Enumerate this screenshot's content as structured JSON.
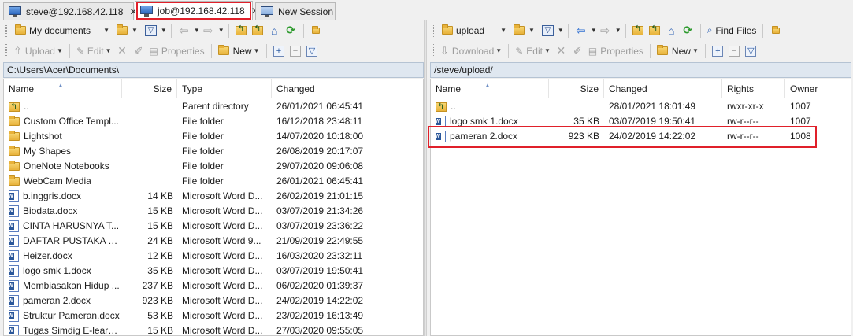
{
  "tabs": [
    {
      "label": "steve@192.168.42.118",
      "close": "✕",
      "active": false
    },
    {
      "label": "job@192.168.42.118",
      "close": "✕",
      "active": true
    },
    {
      "label": "New Session"
    }
  ],
  "left": {
    "location": "My documents",
    "path": "C:\\Users\\Acer\\Documents\\",
    "toolbar2": {
      "upload": "Upload",
      "edit": "Edit",
      "properties": "Properties",
      "new": "New"
    },
    "columns": {
      "name": "Name",
      "size": "Size",
      "type": "Type",
      "changed": "Changed"
    },
    "files": [
      {
        "icon": "updir",
        "name": "..",
        "size": "",
        "type": "Parent directory",
        "changed": "26/01/2021  06:45:41"
      },
      {
        "icon": "folder",
        "name": "Custom Office Templ...",
        "size": "",
        "type": "File folder",
        "changed": "16/12/2018  23:48:11"
      },
      {
        "icon": "folder",
        "name": "Lightshot",
        "size": "",
        "type": "File folder",
        "changed": "14/07/2020  10:18:00"
      },
      {
        "icon": "folder",
        "name": "My Shapes",
        "size": "",
        "type": "File folder",
        "changed": "26/08/2019  20:17:07"
      },
      {
        "icon": "folder",
        "name": "OneNote Notebooks",
        "size": "",
        "type": "File folder",
        "changed": "29/07/2020  09:06:08"
      },
      {
        "icon": "folder",
        "name": "WebCam Media",
        "size": "",
        "type": "File folder",
        "changed": "26/01/2021  06:45:41"
      },
      {
        "icon": "word",
        "name": "b.inggris.docx",
        "size": "14 KB",
        "type": "Microsoft Word D...",
        "changed": "26/02/2019  21:01:15"
      },
      {
        "icon": "word",
        "name": "Biodata.docx",
        "size": "15 KB",
        "type": "Microsoft Word D...",
        "changed": "03/07/2019  21:34:26"
      },
      {
        "icon": "word",
        "name": "CINTA HARUSNYA T...",
        "size": "15 KB",
        "type": "Microsoft Word D...",
        "changed": "03/07/2019  23:36:22"
      },
      {
        "icon": "word",
        "name": "DAFTAR PUSTAKA m...",
        "size": "24 KB",
        "type": "Microsoft Word 9...",
        "changed": "21/09/2019  22:49:55"
      },
      {
        "icon": "word",
        "name": "Heizer.docx",
        "size": "12 KB",
        "type": "Microsoft Word D...",
        "changed": "16/03/2020  23:32:11"
      },
      {
        "icon": "word",
        "name": "logo smk 1.docx",
        "size": "35 KB",
        "type": "Microsoft Word D...",
        "changed": "03/07/2019  19:50:41"
      },
      {
        "icon": "word",
        "name": "Membiasakan Hidup ...",
        "size": "237 KB",
        "type": "Microsoft Word D...",
        "changed": "06/02/2020  01:39:37"
      },
      {
        "icon": "word",
        "name": "pameran 2.docx",
        "size": "923 KB",
        "type": "Microsoft Word D...",
        "changed": "24/02/2019  14:22:02"
      },
      {
        "icon": "word",
        "name": "Struktur Pameran.docx",
        "size": "53 KB",
        "type": "Microsoft Word D...",
        "changed": "23/02/2019  16:13:49"
      },
      {
        "icon": "word",
        "name": "Tugas Simdig E-learni...",
        "size": "15 KB",
        "type": "Microsoft Word D...",
        "changed": "27/03/2020  09:55:05"
      }
    ]
  },
  "right": {
    "location": "upload",
    "path": "/steve/upload/",
    "find_files": "Find Files",
    "toolbar2": {
      "download": "Download",
      "edit": "Edit",
      "properties": "Properties",
      "new": "New"
    },
    "columns": {
      "name": "Name",
      "size": "Size",
      "changed": "Changed",
      "rights": "Rights",
      "owner": "Owner"
    },
    "files": [
      {
        "icon": "updir",
        "name": "..",
        "size": "",
        "changed": "28/01/2021 18:01:49",
        "rights": "rwxr-xr-x",
        "owner": "1007"
      },
      {
        "icon": "word",
        "name": "logo smk 1.docx",
        "size": "35 KB",
        "changed": "03/07/2019 19:50:41",
        "rights": "rw-r--r--",
        "owner": "1007"
      },
      {
        "icon": "word",
        "name": "pameran 2.docx",
        "size": "923 KB",
        "changed": "24/02/2019 14:22:02",
        "rights": "rw-r--r--",
        "owner": "1008"
      }
    ]
  },
  "colors": {
    "highlight": "#e0202a",
    "pathbar": "#dfe7f0"
  }
}
